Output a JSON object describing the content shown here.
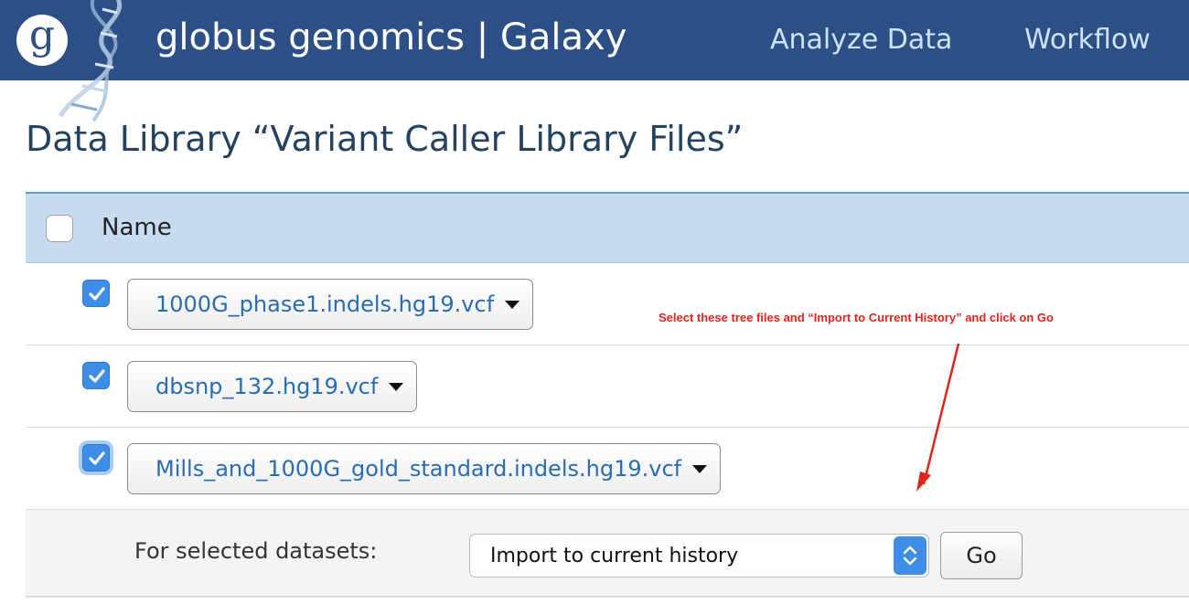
{
  "navbar": {
    "logo_letter": "g",
    "brand_title": "globus genomics | Galaxy",
    "links": [
      "Analyze Data",
      "Workflow"
    ],
    "background_color": "#2c4f86"
  },
  "page": {
    "title": "Data Library “Variant Caller Library Files”"
  },
  "table": {
    "header_name": "Name",
    "select_all_checked": false,
    "rows": [
      {
        "name": "1000G_phase1.indels.hg19.vcf",
        "checked": true
      },
      {
        "name": "dbsnp_132.hg19.vcf",
        "checked": true
      },
      {
        "name": "Mills_and_1000G_gold_standard.indels.hg19.vcf",
        "checked": true
      }
    ]
  },
  "annotation": {
    "text": "Select these tree files and “Import to Current History” and click on Go",
    "color": "#e0241c"
  },
  "actions": {
    "label": "For selected datasets:",
    "selected_option": "Import to current history",
    "go_label": "Go"
  },
  "icons": {
    "checkbox_checked": "check-icon",
    "dropdown_caret": "caret-down-icon",
    "select_stepper": "up-down-chevron-icon",
    "logo_graphic": "dna-helix-icon"
  }
}
